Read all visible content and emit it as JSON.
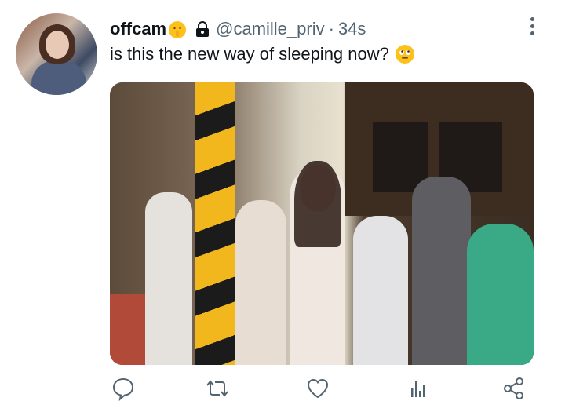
{
  "tweet": {
    "display_name": "offcam",
    "handle": "@camille_priv",
    "separator": "·",
    "time": "34s",
    "text": "is this the new way of sleeping now?"
  },
  "icons": {
    "name_emoji": "shushing-face-emoji",
    "lock": "lock-icon",
    "text_emoji": "rolling-eyes-emoji",
    "more": "more-vertical-icon",
    "reply": "reply-icon",
    "retweet": "retweet-icon",
    "like": "heart-icon",
    "views": "analytics-icon",
    "share": "share-icon"
  },
  "colors": {
    "secondary_text": "#536471",
    "emoji": "#fcc21b"
  }
}
